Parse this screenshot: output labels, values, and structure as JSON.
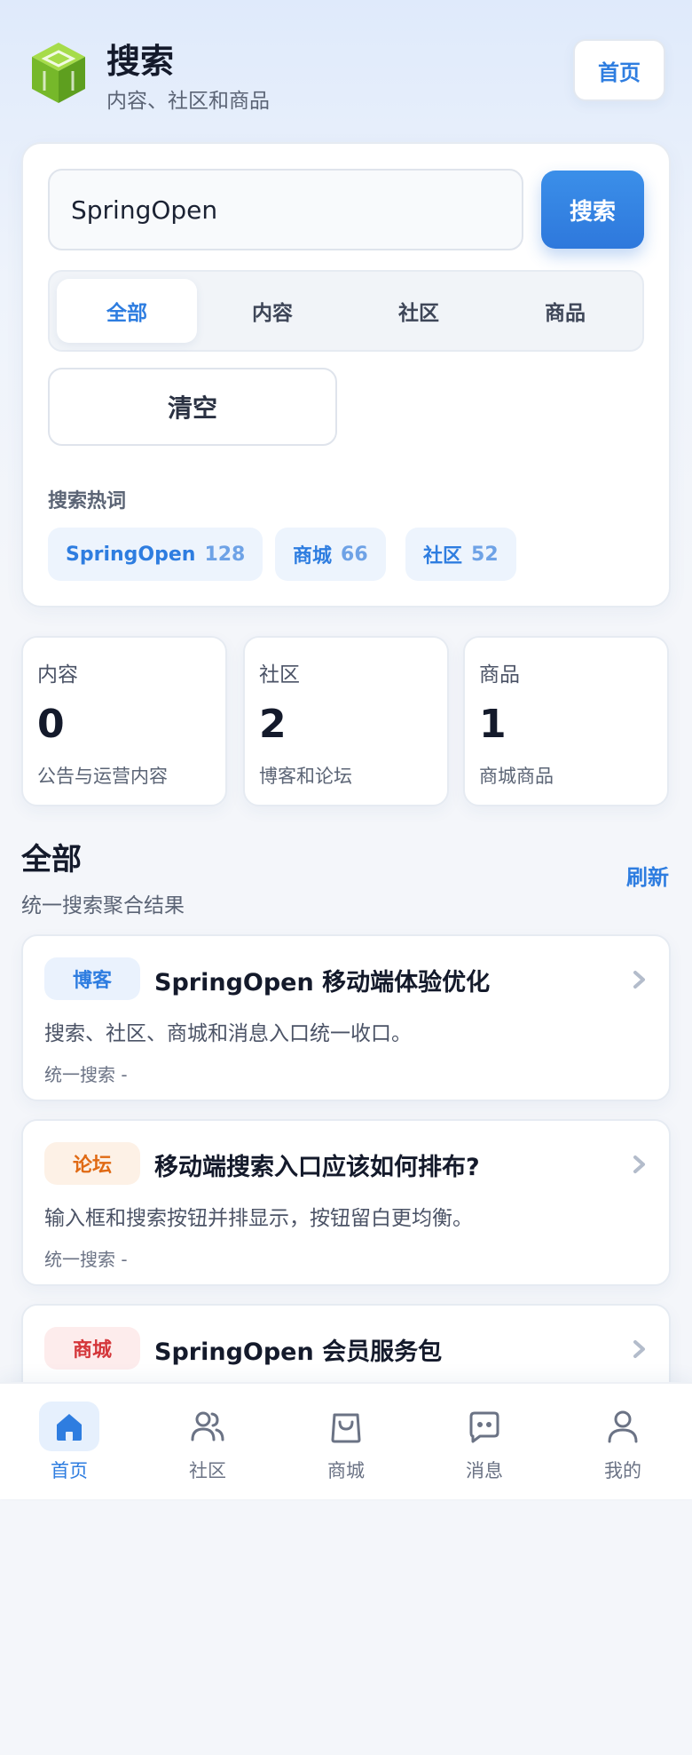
{
  "header": {
    "title": "搜索",
    "subtitle": "内容、社区和商品",
    "home_button": "首页",
    "logo_icon": "cube-logo-icon"
  },
  "search": {
    "query": "SpringOpen",
    "button": "搜索",
    "tabs": [
      {
        "label": "全部",
        "active": true
      },
      {
        "label": "内容",
        "active": false
      },
      {
        "label": "社区",
        "active": false
      },
      {
        "label": "商品",
        "active": false
      }
    ],
    "clear_button": "清空",
    "hot_title": "搜索热词",
    "hot_words": [
      {
        "word": "SpringOpen",
        "count": "128"
      },
      {
        "word": "商城",
        "count": "66"
      },
      {
        "word": "社区",
        "count": "52"
      }
    ]
  },
  "stats": [
    {
      "label": "内容",
      "value": "0",
      "desc": "公告与运营内容"
    },
    {
      "label": "社区",
      "value": "2",
      "desc": "博客和论坛"
    },
    {
      "label": "商品",
      "value": "1",
      "desc": "商城商品"
    }
  ],
  "section": {
    "title": "全部",
    "subtitle": "统一搜索聚合结果",
    "refresh": "刷新"
  },
  "results": [
    {
      "badge": "博客",
      "title": "SpringOpen 移动端体验优化",
      "desc": "搜索、社区、商城和消息入口统一收口。",
      "meta": "统一搜索   -"
    },
    {
      "badge": "论坛",
      "title": "移动端搜索入口应该如何排布?",
      "desc": "输入框和搜索按钮并排显示，按钮留白更均衡。",
      "meta": "统一搜索   -"
    },
    {
      "badge": "商城",
      "title": "SpringOpen 会员服务包",
      "desc": "",
      "meta": ""
    }
  ],
  "nav": [
    {
      "label": "首页",
      "icon": "home-icon",
      "active": true
    },
    {
      "label": "社区",
      "icon": "users-icon",
      "active": false
    },
    {
      "label": "商城",
      "icon": "shopping-bag-icon",
      "active": false
    },
    {
      "label": "消息",
      "icon": "message-icon",
      "active": false
    },
    {
      "label": "我的",
      "icon": "user-icon",
      "active": false
    }
  ],
  "colors": {
    "accent": "#2e7de0",
    "badge_blog": "#2e7de0",
    "badge_forum": "#e06a14",
    "badge_mall": "#d4363a",
    "logo_green": "#7cc02a"
  }
}
